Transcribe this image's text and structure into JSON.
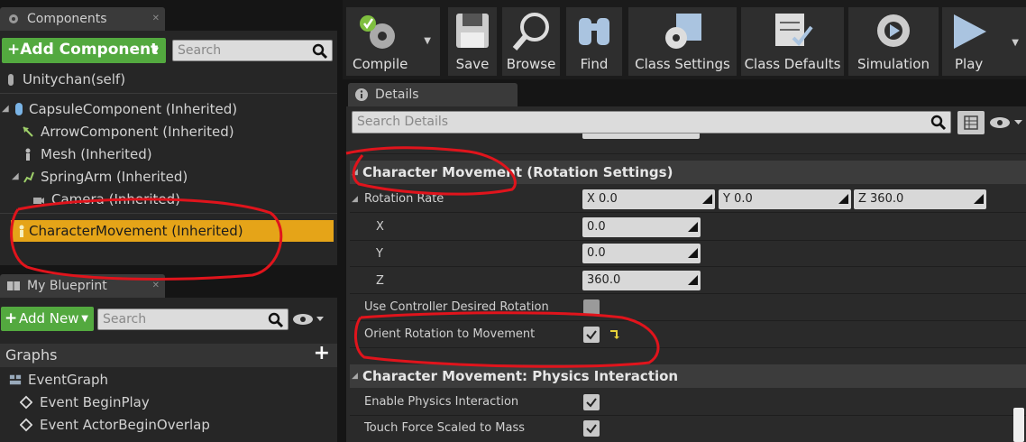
{
  "components_panel": {
    "tab_label": "Components",
    "add_button_label": "+Add Component",
    "search_placeholder": "Search",
    "self_item": "Unitychan(self)",
    "items": [
      {
        "label": "CapsuleComponent (Inherited)"
      },
      {
        "label": "ArrowComponent (Inherited)"
      },
      {
        "label": "Mesh (Inherited)"
      },
      {
        "label": "SpringArm (Inherited)"
      },
      {
        "label": "Camera (Inherited)"
      },
      {
        "label": "CharacterMovement (Inherited)"
      }
    ]
  },
  "blueprint_panel": {
    "tab_label": "My Blueprint",
    "add_button_label": "Add New",
    "search_placeholder": "Search",
    "graphs_label": "Graphs",
    "graphs_add": "+",
    "items": [
      {
        "label": "EventGraph"
      },
      {
        "label": "Event BeginPlay"
      },
      {
        "label": "Event ActorBeginOverlap"
      }
    ]
  },
  "toolbar": {
    "buttons": [
      {
        "label": "Compile"
      },
      {
        "label": "Save"
      },
      {
        "label": "Browse"
      },
      {
        "label": "Find"
      },
      {
        "label": "Class Settings"
      },
      {
        "label": "Class Defaults"
      },
      {
        "label": "Simulation"
      },
      {
        "label": "Play"
      }
    ]
  },
  "details_panel": {
    "tab_label": "Details",
    "search_placeholder": "Search Details",
    "section_rotation": "Character Movement (Rotation Settings)",
    "rotation_rate_label": "Rotation Rate",
    "rotation_rate": {
      "x": "X  0.0",
      "y": "Y  0.0",
      "z": "Z  360.0"
    },
    "axis_labels": {
      "x": "X",
      "y": "Y",
      "z": "Z"
    },
    "axis_values": {
      "x": "0.0",
      "y": "0.0",
      "z": "360.0"
    },
    "use_controller_label": "Use Controller Desired Rotation",
    "orient_label": "Orient Rotation to Movement",
    "section_physics": "Character Movement: Physics Interaction",
    "enable_physics_label": "Enable Physics Interaction",
    "touch_force_label": "Touch Force Scaled to Mass"
  },
  "colors": {
    "selection": "#e5a418",
    "green_button": "#53a93f",
    "annotation_red": "#e0141c",
    "panel_bg": "#262626",
    "header_bg": "#3c3c3c"
  }
}
